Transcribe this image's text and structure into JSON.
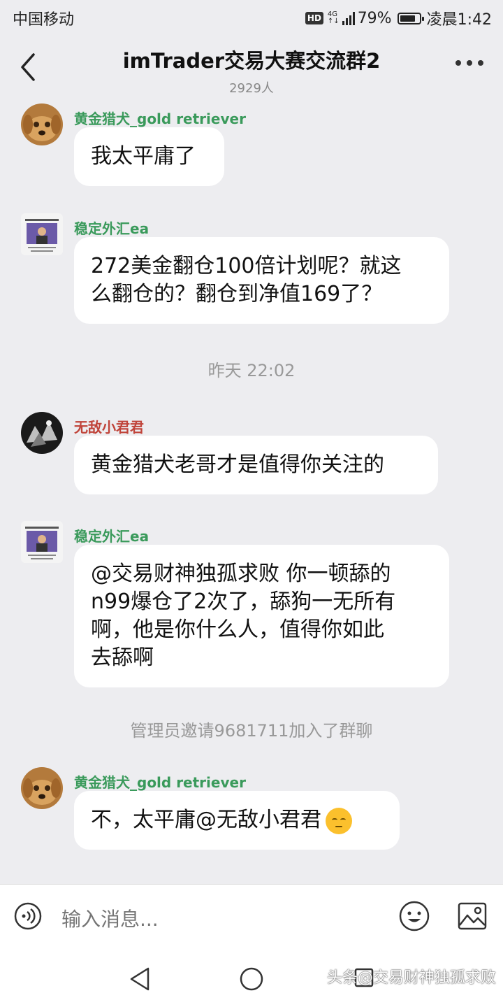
{
  "status_bar": {
    "carrier": "中国移动",
    "hd": "HD",
    "network_top": "4G",
    "network_bottom": "↑↓",
    "battery": "79%",
    "battery_level": 0.79,
    "time": "凌晨1:42"
  },
  "header": {
    "title": "imTrader交易大赛交流群2",
    "member_count": "2929人"
  },
  "messages": [
    {
      "sender": "黄金猎犬_gold retriever",
      "sender_color": "#3a9a5b",
      "lines": [
        "我太平庸了"
      ]
    },
    {
      "sender": "稳定外汇ea",
      "sender_color": "#3a9a5b",
      "lines": [
        "272美金翻仓100倍计划呢？就这",
        "么翻仓的？翻仓到净值169了？"
      ]
    },
    {
      "sender": "无敌小君君",
      "sender_color": "#c0443a",
      "lines": [
        "黄金猎犬老哥才是值得你关注的"
      ]
    },
    {
      "sender": "稳定外汇ea",
      "sender_color": "#3a9a5b",
      "lines": [
        "@交易财神独孤求败 你一顿舔的",
        "n99爆仓了2次了，舔狗一无所有",
        "啊，他是你什么人，值得你如此",
        "去舔啊"
      ]
    },
    {
      "sender": "黄金猎犬_gold retriever",
      "sender_color": "#3a9a5b",
      "lines": [
        "不，太平庸@无敌小君君"
      ],
      "emoji": "pensive-face"
    }
  ],
  "timestamp": "昨天 22:02",
  "system_notice": "管理员邀请9681711加入了群聊",
  "input": {
    "placeholder": "输入消息..."
  },
  "watermark": "头条@交易财神独孤求败",
  "colors": {
    "background": "#ededf0",
    "bubble": "#ffffff",
    "sender_green": "#3a9a5b",
    "sender_red": "#c0443a"
  }
}
